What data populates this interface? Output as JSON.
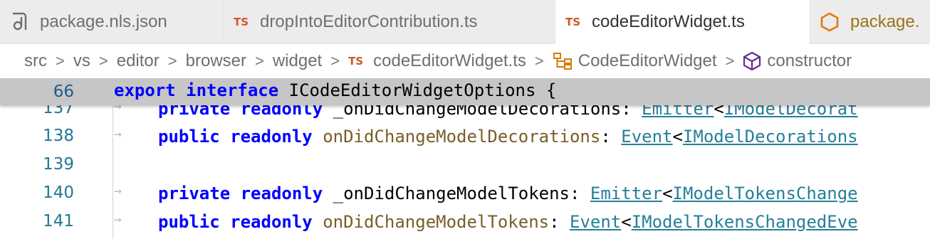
{
  "tabs": [
    {
      "label": "package.nls.json",
      "icon": "json-file-icon"
    },
    {
      "label": "dropIntoEditorContribution.ts",
      "badge": "TS"
    },
    {
      "label": "codeEditorWidget.ts",
      "badge": "TS",
      "active": true
    },
    {
      "label": "package.",
      "icon": "nodejs-hexagon-icon"
    }
  ],
  "breadcrumb": {
    "items": [
      "src",
      "vs",
      "editor",
      "browser",
      "widget"
    ],
    "file_badge": "TS",
    "file": "codeEditorWidget.ts",
    "class": "CodeEditorWidget",
    "member": "constructor",
    "separator": ">"
  },
  "sticky": {
    "line_number": "66",
    "tokens": [
      "export",
      " ",
      "interface",
      " ",
      "ICodeEditorWidgetOptions",
      " {"
    ]
  },
  "lines": [
    {
      "number": "137",
      "t1": "private",
      "t2": "readonly",
      "t3": "_onDidChangeModelDecorations",
      "t4": ": ",
      "t5": "Emitter",
      "t6": "<",
      "t7": "IModelDecorat"
    },
    {
      "number": "138",
      "t1": "public",
      "t2": "readonly",
      "t3": "onDidChangeModelDecorations",
      "t4": ": ",
      "t5": "Event",
      "t6": "<",
      "t7": "IModelDecorations"
    },
    {
      "number": "139"
    },
    {
      "number": "140",
      "t1": "private",
      "t2": "readonly",
      "t3": "_onDidChangeModelTokens",
      "t4": ": ",
      "t5": "Emitter",
      "t6": "<",
      "t7": "IModelTokensChange"
    },
    {
      "number": "141",
      "t1": "public",
      "t2": "readonly",
      "t3": "onDidChangeModelTokens",
      "t4": ": ",
      "t5": "Event",
      "t6": "<",
      "t7": "IModelTokensChangedEve"
    }
  ],
  "indent_arrow": "→",
  "colors": {
    "keyword": "#0000ff",
    "property": "#795e26",
    "type": "#267f99",
    "line_number": "#237893",
    "ts_badge": "#d1572a",
    "sticky_bg": "#c6c6c6"
  }
}
